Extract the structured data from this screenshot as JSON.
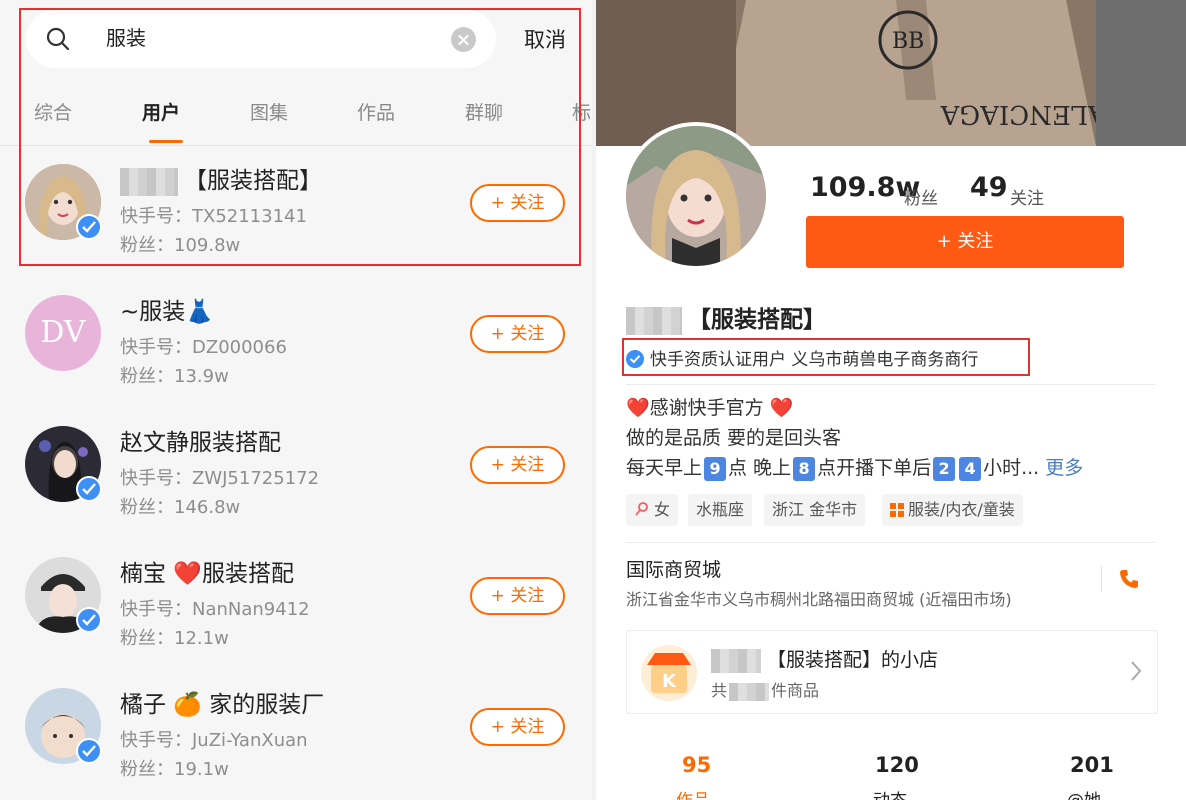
{
  "search": {
    "query": "服装",
    "cancel_label": "取消"
  },
  "tabs": [
    "综合",
    "用户",
    "图集",
    "作品",
    "群聊",
    "标"
  ],
  "active_tab": "用户",
  "follow_label": "+ 关注",
  "users": [
    {
      "name": "【服装搭配】",
      "code": "快手号：TX52113141",
      "fans": "粉丝：109.8w",
      "verified": true,
      "avatar_letters": ""
    },
    {
      "name": "~服装👗",
      "code": "快手号：DZ000066",
      "fans": "粉丝：13.9w",
      "verified": false,
      "avatar_letters": "DV"
    },
    {
      "name": "赵文静服装搭配",
      "code": "快手号：ZWJ51725172",
      "fans": "粉丝：146.8w",
      "verified": true,
      "avatar_letters": ""
    },
    {
      "name": "楠宝 ❤️服装搭配",
      "code": "快手号：NanNan9412",
      "fans": "粉丝：12.1w",
      "verified": true,
      "avatar_letters": ""
    },
    {
      "name": "橘子 🍊 家的服装厂",
      "code": "快手号：JuZi-YanXuan",
      "fans": "粉丝：19.1w",
      "verified": true,
      "avatar_letters": ""
    }
  ],
  "profile": {
    "fans_num": "109.8w",
    "fans_label": "粉丝",
    "following_num": "49",
    "following_label": "关注",
    "follow_button": "+ 关注",
    "name": "【服装搭配】",
    "verify_text": "快手资质认证用户 义乌市萌兽电子商务商行",
    "bio_line1": "❤️感谢快手官方 ❤️",
    "bio_line2": "做的是品质 要的是回头客",
    "bio_line3_a": "每天早上",
    "bio_line3_n1": "9",
    "bio_line3_b": "点 晚上",
    "bio_line3_n2": "8",
    "bio_line3_c": "点开播下单后",
    "bio_line3_n3": "2",
    "bio_line3_n4": "4",
    "bio_line3_d": "小时...",
    "bio_more": "更多",
    "chips": [
      "女",
      "水瓶座",
      "浙江 金华市",
      "服装/内衣/童装"
    ],
    "location_title": "国际商贸城",
    "location_address": "浙江省金华市义乌市稠州北路福田商贸城 (近福田市场)",
    "shop_name": "【服装搭配】的小店",
    "shop_sub_prefix": "共",
    "shop_sub_suffix": "件商品",
    "bottom_tabs": [
      {
        "num": "95",
        "label": "作品"
      },
      {
        "num": "120",
        "label": "动态"
      },
      {
        "num": "201",
        "label": "@她"
      }
    ]
  },
  "colors": {
    "accent": "#ff6a00",
    "verify_blue": "#3e8ff5",
    "highlight_red": "#e0322e"
  }
}
